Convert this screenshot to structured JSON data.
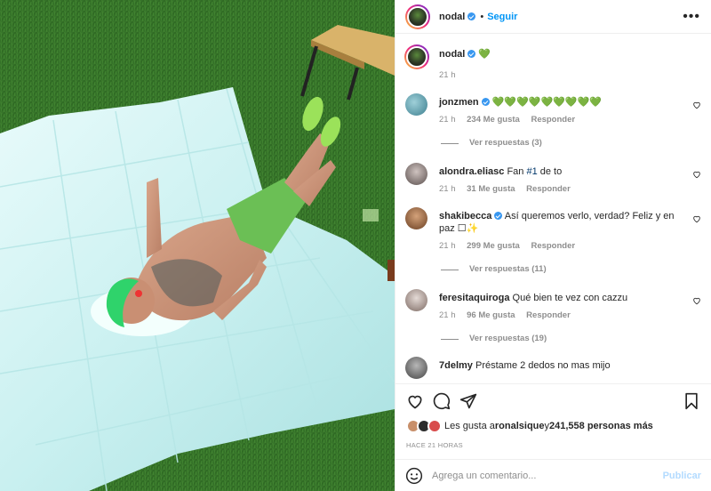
{
  "post": {
    "author": "nodal",
    "follow_label": "Seguir",
    "dot": "•",
    "more": "•••"
  },
  "caption": {
    "user": "nodal",
    "text": "💚",
    "time": "21 h"
  },
  "comments": [
    {
      "user": "jonzmen",
      "verified": true,
      "text": "💚💚💚💚💚💚💚💚💚",
      "time": "21 h",
      "likes": "234 Me gusta",
      "reply": "Responder",
      "replies": "Ver respuestas (3)"
    },
    {
      "user": "alondra.eliasc",
      "verified": false,
      "text_a": "Fan ",
      "text_hash": "#1",
      "text_b": " de to",
      "time": "21 h",
      "likes": "31 Me gusta",
      "reply": "Responder"
    },
    {
      "user": "shakibecca",
      "verified": true,
      "text": "Así queremos verlo, verdad? Feliz y en paz ☐✨",
      "time": "21 h",
      "likes": "299 Me gusta",
      "reply": "Responder",
      "replies": "Ver respuestas (11)"
    },
    {
      "user": "feresitaquiroga",
      "verified": false,
      "text": "Qué bien te vez con cazzu",
      "time": "21 h",
      "likes": "96 Me gusta",
      "reply": "Responder",
      "replies": "Ver respuestas (19)"
    },
    {
      "user": "7delmy",
      "verified": false,
      "text": "Préstame 2 dedos no mas mijo"
    }
  ],
  "likes": {
    "prefix": "Les gusta a ",
    "user": "ronalsique",
    "middle": " y ",
    "count": "241,558 personas más"
  },
  "posted_ago": "HACE 21 HORAS",
  "comment_box": {
    "placeholder": "Agrega un comentario...",
    "publish": "Publicar"
  },
  "icons": {
    "like": "heart-icon",
    "comment": "comment-icon",
    "share": "paper-plane-icon",
    "save": "bookmark-icon",
    "emoji": "smiley-icon"
  }
}
